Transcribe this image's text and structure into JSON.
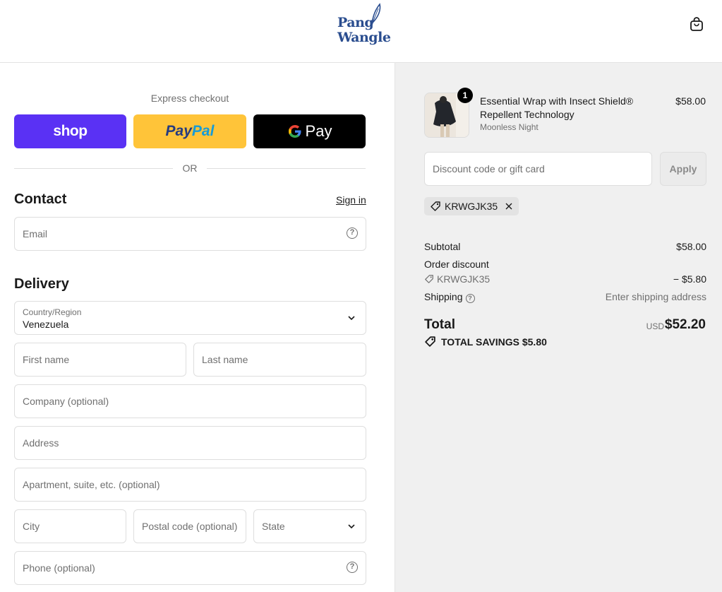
{
  "brand": {
    "line1": "Pang",
    "line2": "Wangle"
  },
  "express": {
    "title": "Express checkout",
    "shop_label": "shop",
    "paypal_part1": "Pay",
    "paypal_part2": "Pal",
    "gpay_label": "Pay",
    "or_label": "OR"
  },
  "contact": {
    "title": "Contact",
    "sign_in": "Sign in",
    "email_placeholder": "Email"
  },
  "delivery": {
    "title": "Delivery",
    "country_label": "Country/Region",
    "country_value": "Venezuela",
    "first_name": "First name",
    "last_name": "Last name",
    "company": "Company (optional)",
    "address": "Address",
    "apartment": "Apartment, suite, etc. (optional)",
    "city": "City",
    "postal": "Postal code (optional)",
    "state": "State",
    "phone": "Phone (optional)"
  },
  "cart": {
    "item": {
      "quantity": "1",
      "name": "Essential Wrap with Insect Shield® Repellent Technology",
      "variant": "Moonless Night",
      "price": "$58.00"
    },
    "discount_placeholder": "Discount code or gift card",
    "apply_label": "Apply",
    "applied_code": "KRWGJK35"
  },
  "summary": {
    "subtotal_label": "Subtotal",
    "subtotal_value": "$58.00",
    "order_discount_label": "Order discount",
    "discount_code": "KRWGJK35",
    "discount_value": "− $5.80",
    "shipping_label": "Shipping",
    "shipping_value": "Enter shipping address",
    "total_label": "Total",
    "currency": "USD",
    "total_value": "$52.20",
    "savings_text": "TOTAL SAVINGS $5.80"
  },
  "colors": {
    "shop_pay": "#5a31f4",
    "paypal": "#ffc439",
    "brand": "#2a4d8f",
    "summary_bg": "#f0f0f0"
  }
}
